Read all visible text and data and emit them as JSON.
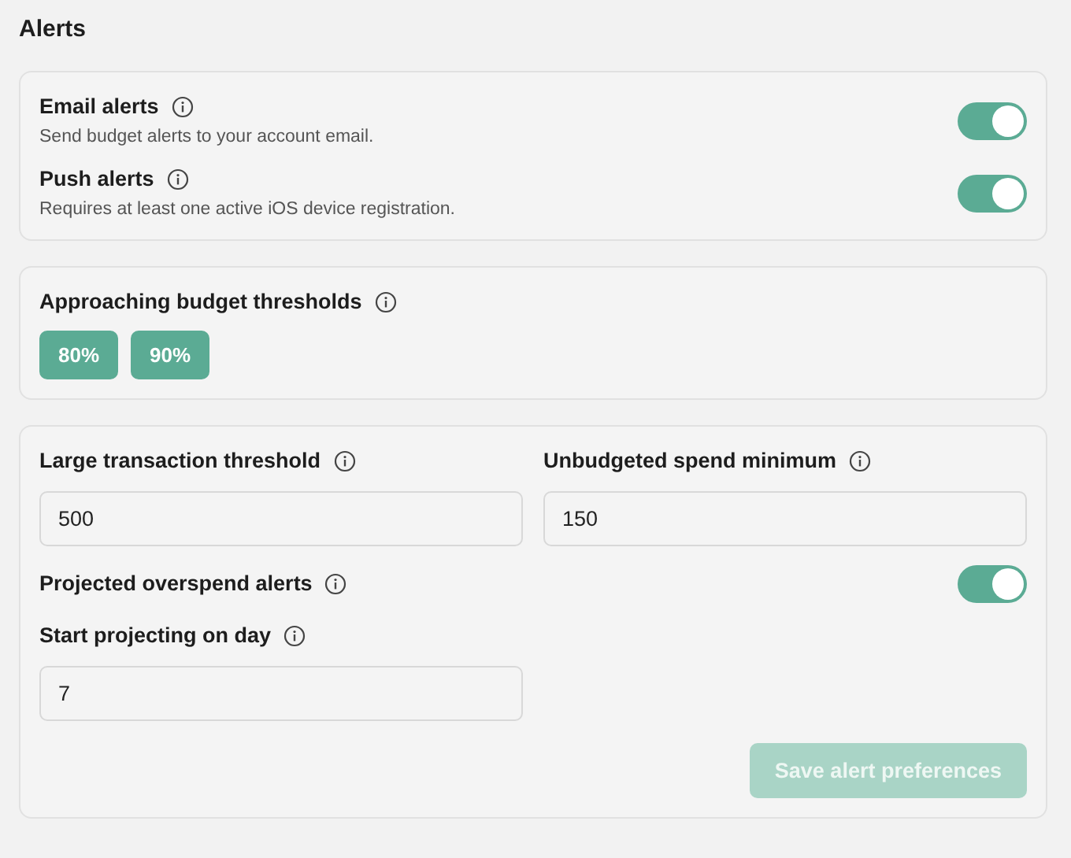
{
  "title": "Alerts",
  "channels": [
    {
      "label": "Email alerts",
      "description": "Send budget alerts to your account email.",
      "on": true
    },
    {
      "label": "Push alerts",
      "description": "Requires at least one active iOS device registration.",
      "on": true
    }
  ],
  "thresholds": {
    "label": "Approaching budget thresholds",
    "options": [
      {
        "label": "80%",
        "selected": true
      },
      {
        "label": "90%",
        "selected": true
      }
    ]
  },
  "limits": {
    "fields": [
      {
        "label": "Large transaction threshold",
        "value": "500"
      },
      {
        "label": "Unbudgeted spend minimum",
        "value": "150"
      }
    ],
    "projected": {
      "label": "Projected overspend alerts",
      "on": true
    },
    "start_day": {
      "label": "Start projecting on day",
      "value": "7"
    },
    "save_button": {
      "label": "Save alert preferences",
      "disabled": true
    }
  }
}
